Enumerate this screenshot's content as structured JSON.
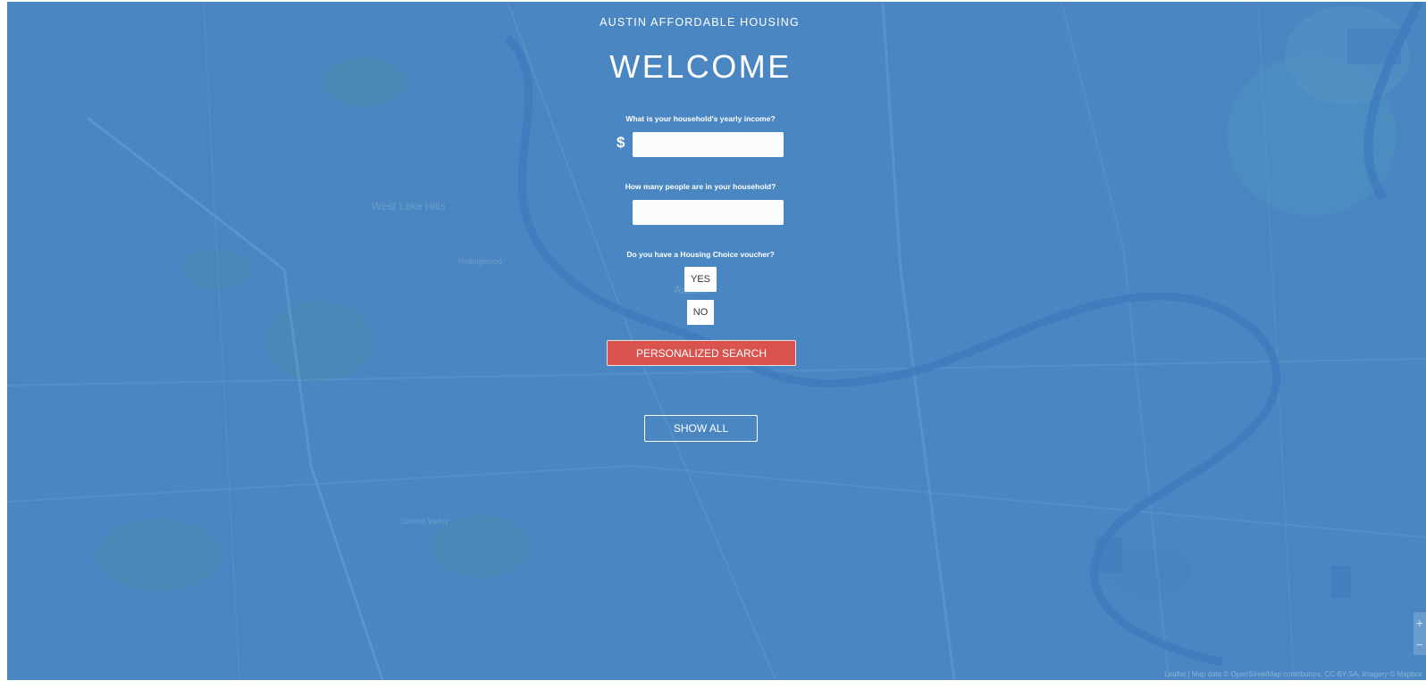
{
  "site": {
    "title": "AUSTIN AFFORDABLE HOUSING",
    "heading": "WELCOME"
  },
  "form": {
    "income_question": "What is your household's yearly income?",
    "currency_symbol": "$",
    "income_value": "",
    "household_question": "How many people are in your household?",
    "household_value": "",
    "voucher_question": "Do you have a Housing Choice voucher?",
    "yes_label": "YES",
    "no_label": "NO",
    "search_label": "PERSONALIZED SEARCH",
    "show_all_label": "SHOW ALL"
  },
  "map": {
    "labels": [
      "West Lake Hills",
      "Rollingwood",
      "Austin",
      "Sunset Valley"
    ],
    "zoom_in": "+",
    "zoom_out": "−",
    "attribution": "Leaflet | Map data © OpenStreetMap contributors, CC-BY-SA, Imagery © Mapbox"
  },
  "colors": {
    "overlay_blue": "#4a87c2",
    "search_red": "#d9534f",
    "text_white": "#ffffff"
  }
}
